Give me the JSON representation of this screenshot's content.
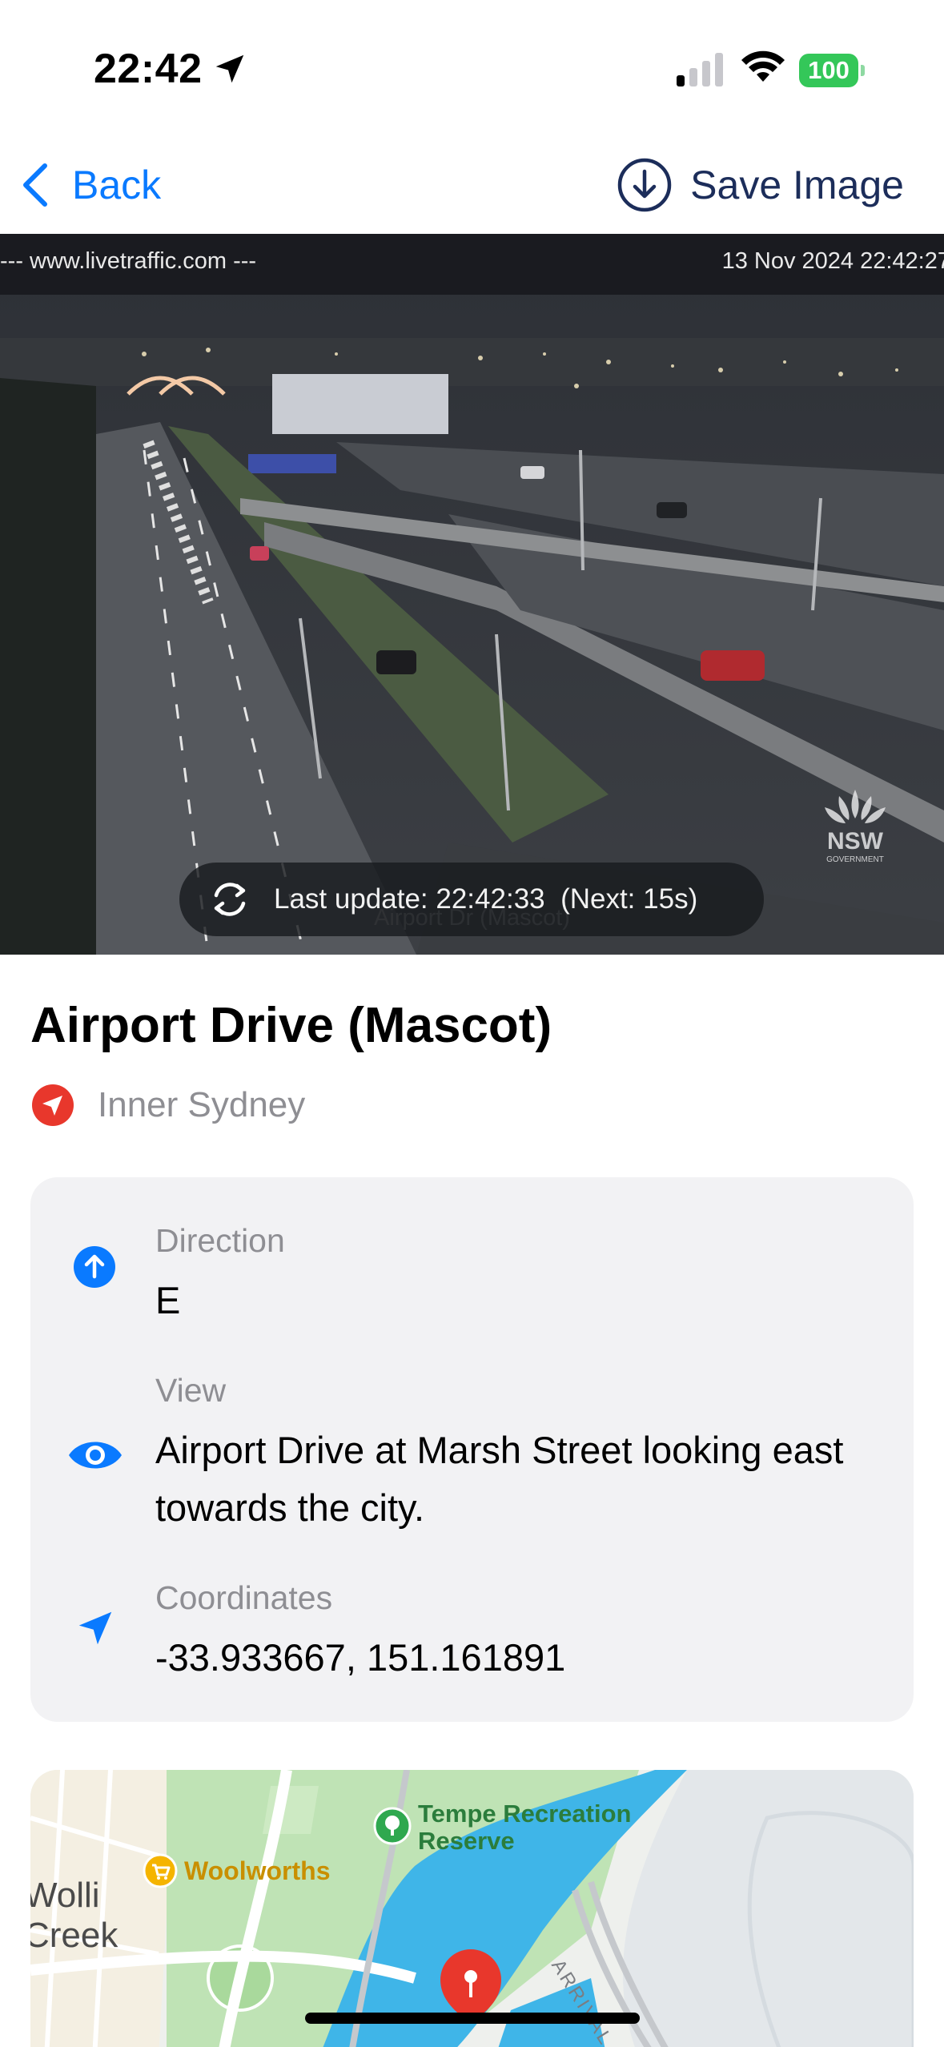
{
  "status_bar": {
    "time": "22:42",
    "battery": "100"
  },
  "nav": {
    "back_label": "Back",
    "save_label": "Save Image"
  },
  "camera": {
    "source_url": "--- www.livetraffic.com ---",
    "timestamp": "13 Nov 2024 22:42:27",
    "caption": "Airport Dr (Mascot)",
    "logo_text": "NSW",
    "logo_subtext": "GOVERNMENT",
    "update_text": "Last update: 22:42:33  (Next: 15s)"
  },
  "place": {
    "title": "Airport Drive (Mascot)",
    "region": "Inner Sydney"
  },
  "details": {
    "direction_label": "Direction",
    "direction_value": "E",
    "view_label": "View",
    "view_value": "Airport Drive at Marsh Street looking east towards the city.",
    "coordinates_label": "Coordinates",
    "coordinates_value": "-33.933667, 151.161891"
  },
  "map": {
    "poi_park": "Tempe Recreation Reserve",
    "poi_park_line1": "Tempe Recreation",
    "poi_park_line2": "Reserve",
    "poi_store": "Woolworths",
    "suburb_line1": "Wolli",
    "suburb_line2": "Creek",
    "road_label": "ARRIVAL"
  },
  "colors": {
    "accent_blue": "#0a7aff",
    "battery_green": "#34c759",
    "pin_red": "#e8372c"
  }
}
